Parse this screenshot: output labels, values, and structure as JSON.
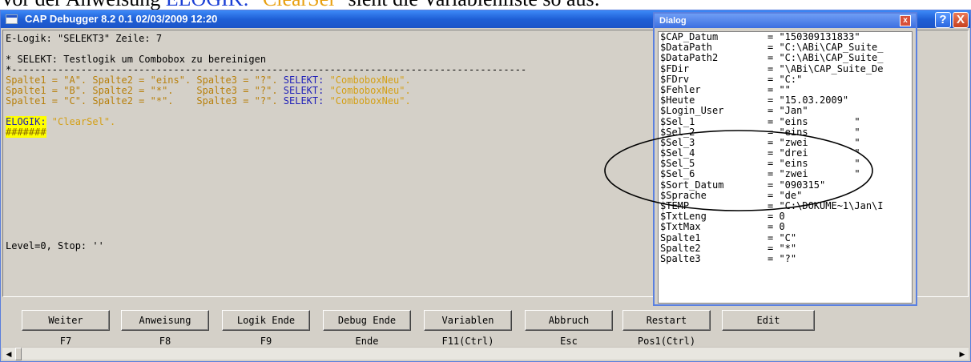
{
  "doc": {
    "prefix": "Vor der Anweisung ",
    "kw": "ELOGIK:",
    "mid": " ",
    "str": "\"ClearSel\"",
    "suffix": " sieht die Variablenliste so aus:"
  },
  "window": {
    "title": "CAP Debugger   8.2 0.1   02/03/2009  12:20",
    "help_label": "?",
    "close_label": "X"
  },
  "code": {
    "header": "E-Logik: \"SELEKT3\" Zeile: 7",
    "comment": "* SELEKT: Testlogik um Combobox zu bereinigen",
    "rule": "*-----------------------------------------------------------------------------------------",
    "lines": [
      {
        "a": "Spalte1 = \"A\". Spalte2 = \"eins\". Spalte3 = \"?\". ",
        "kw": "SELEKT:",
        "b": " \"ComboboxNeu\"."
      },
      {
        "a": "Spalte1 = \"B\". Spalte2 = \"*\".    Spalte3 = \"?\". ",
        "kw": "SELEKT:",
        "b": " \"ComboboxNeu\"."
      },
      {
        "a": "Spalte1 = \"C\". Spalte2 = \"*\".    Spalte3 = \"?\". ",
        "kw": "SELEKT:",
        "b": " \"ComboboxNeu\"."
      }
    ],
    "elogik_kw": "ELOGIK:",
    "elogik_val": " \"ClearSel\".",
    "hashes": "#######",
    "status": "Level=0, Stop: ''"
  },
  "buttons": [
    {
      "label": "Weiter",
      "key": "F7"
    },
    {
      "label": "Anweisung",
      "key": "F8"
    },
    {
      "label": "Logik Ende",
      "key": "F9"
    },
    {
      "label": "Debug Ende",
      "key": "Ende"
    },
    {
      "label": "Variablen",
      "key": "F11(Ctrl)"
    },
    {
      "label": "Abbruch",
      "key": "Esc"
    },
    {
      "label": "Restart",
      "key": "Pos1(Ctrl)"
    },
    {
      "label": "Edit",
      "key": ""
    }
  ],
  "dialog": {
    "title": "Dialog",
    "close_label": "x",
    "vars": [
      {
        "name": "$CAP_Datum",
        "value": "= \"150309131833\""
      },
      {
        "name": "$DataPath",
        "value": "= \"C:\\ABi\\CAP_Suite_"
      },
      {
        "name": "$DataPath2",
        "value": "= \"C:\\ABi\\CAP_Suite_"
      },
      {
        "name": "$FDir",
        "value": "= \"\\ABi\\CAP_Suite_De"
      },
      {
        "name": "$FDrv",
        "value": "= \"C:\""
      },
      {
        "name": "$Fehler",
        "value": "= \"\""
      },
      {
        "name": "$Heute",
        "value": "= \"15.03.2009\""
      },
      {
        "name": "$Login_User",
        "value": "= \"Jan\""
      },
      {
        "name": "$Sel_1",
        "value": "= \"eins        \""
      },
      {
        "name": "$Sel_2",
        "value": "= \"eins        \""
      },
      {
        "name": "$Sel_3",
        "value": "= \"zwei        \""
      },
      {
        "name": "$Sel_4",
        "value": "= \"drei        \""
      },
      {
        "name": "$Sel_5",
        "value": "= \"eins        \""
      },
      {
        "name": "$Sel_6",
        "value": "= \"zwei        \""
      },
      {
        "name": "$Sort_Datum",
        "value": "= \"090315\""
      },
      {
        "name": "$Sprache",
        "value": "= \"de\""
      },
      {
        "name": "$TEMP",
        "value": "= \"C:\\DOKUME~1\\Jan\\I"
      },
      {
        "name": "$TxtLeng",
        "value": "= 0"
      },
      {
        "name": "$TxtMax",
        "value": "= 0"
      },
      {
        "name": "Spalte1",
        "value": "= \"C\""
      },
      {
        "name": "Spalte2",
        "value": "= \"*\""
      },
      {
        "name": "Spalte3",
        "value": "= \"?\""
      }
    ]
  },
  "colors": {
    "title_blue": "#1f5fd6",
    "keyword_blue": "#1f1fb8",
    "string_yellow": "#d4a017",
    "highlight": "#ffff00"
  }
}
